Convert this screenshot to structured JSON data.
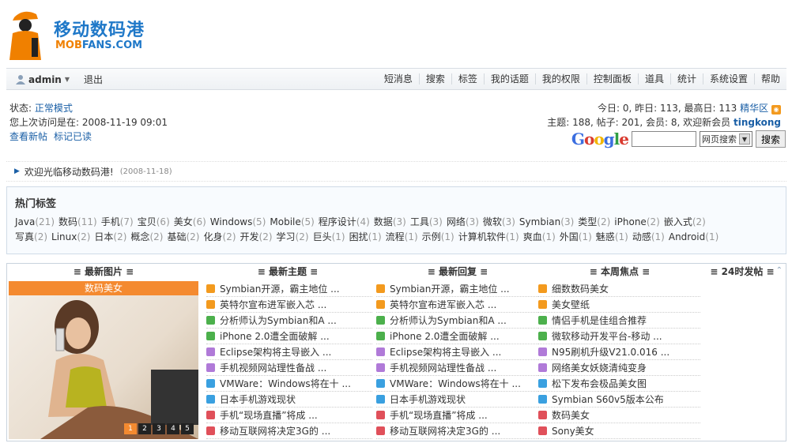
{
  "brand": {
    "cn": "移动数码港",
    "en_a": "MOB",
    "en_b": "FANS.COM"
  },
  "nav": {
    "user": "admin",
    "logout": "退出",
    "menu": [
      "短消息",
      "搜索",
      "标签",
      "我的话题",
      "我的权限",
      "控制面板",
      "道具",
      "统计",
      "系统设置",
      "帮助"
    ]
  },
  "status": {
    "label": "状态:",
    "mode": "正常模式",
    "last_visit": "您上次访问是在: 2008-11-19 09:01",
    "new_posts": "查看新帖",
    "mark_read": "标记已读"
  },
  "stats": {
    "line1": "今日: 0, 昨日: 113, 最高日: 113",
    "digest": "精华区",
    "line2": "主题: 188, 帖子: 201, 会员: 8, 欢迎新会员",
    "new_member": "tingkong"
  },
  "google": {
    "logo": "Google",
    "select": "网页搜索",
    "button": "搜索"
  },
  "welcome": {
    "text": "欢迎光临移动数码港!",
    "date": "(2008-11-18)"
  },
  "tags": {
    "title": "热门标签",
    "row1": [
      [
        "Java",
        "21"
      ],
      [
        "数码",
        "11"
      ],
      [
        "手机",
        "7"
      ],
      [
        "宝贝",
        "6"
      ],
      [
        "美女",
        "6"
      ],
      [
        "Windows",
        "5"
      ],
      [
        "Mobile",
        "5"
      ],
      [
        "程序设计",
        "4"
      ],
      [
        "数据",
        "3"
      ],
      [
        "工具",
        "3"
      ],
      [
        "网络",
        "3"
      ],
      [
        "微软",
        "3"
      ],
      [
        "Symbian",
        "3"
      ],
      [
        "类型",
        "2"
      ],
      [
        "iPhone",
        "2"
      ],
      [
        "嵌入式",
        "2"
      ]
    ],
    "row2": [
      [
        "写真",
        "2"
      ],
      [
        "Linux",
        "2"
      ],
      [
        "日本",
        "2"
      ],
      [
        "概念",
        "2"
      ],
      [
        "基础",
        "2"
      ],
      [
        "化身",
        "2"
      ],
      [
        "开发",
        "2"
      ],
      [
        "学习",
        "2"
      ],
      [
        "巨头",
        "1"
      ],
      [
        "困扰",
        "1"
      ],
      [
        "流程",
        "1"
      ],
      [
        "示例",
        "1"
      ],
      [
        "计算机软件",
        "1"
      ],
      [
        "爽血",
        "1"
      ],
      [
        "外国",
        "1"
      ],
      [
        "魅惑",
        "1"
      ],
      [
        "动感",
        "1"
      ],
      [
        "Android",
        "1"
      ]
    ]
  },
  "boxes": {
    "heads": [
      "≡ 最新图片 ≡",
      "≡ 最新主题 ≡",
      "≡ 最新回复 ≡",
      "≡ 本周焦点 ≡",
      "≡ 24时发帖 ≡"
    ],
    "pic_caption": "数码美女",
    "pager": [
      "1",
      "2",
      "3",
      "4",
      "5"
    ],
    "latest": [
      "Symbian开源，霸主地位 ...",
      "英特尔宣布进军嵌入芯 ...",
      "分析师认为Symbian和A ...",
      "iPhone 2.0遭全面破解 ...",
      "Eclipse架构将主导嵌入 ...",
      "手机视频网站理性备战 ...",
      "VMWare：Windows将在十 ...",
      "日本手机游戏现状",
      "手机“现场直播”将成 ...",
      "移动互联网将决定3G的 ..."
    ],
    "replies": [
      "Symbian开源，霸主地位 ...",
      "英特尔宣布进军嵌入芯 ...",
      "分析师认为Symbian和A ...",
      "iPhone 2.0遭全面破解 ...",
      "Eclipse架构将主导嵌入 ...",
      "手机视频网站理性备战 ...",
      "VMWare：Windows将在十 ...",
      "日本手机游戏现状",
      "手机“现场直播”将成 ...",
      "移动互联网将决定3G的 ..."
    ],
    "focus": [
      "细数数码美女",
      "美女壁纸",
      "情侣手机是佳组合推荐",
      "微软移动开发平台-移动 ...",
      "N95刷机升级V21.0.016 ...",
      "网络美女妖娆清纯变身",
      "松下发布会极品美女图",
      "Symbian S60v5版本公布",
      "数码美女",
      "Sony美女"
    ],
    "icon_colors": [
      "#f39a1e",
      "#f39a1e",
      "#4cb04c",
      "#4cb04c",
      "#b07ad8",
      "#b07ad8",
      "#3aa0e0",
      "#3aa0e0",
      "#e0505a",
      "#e0505a"
    ]
  }
}
